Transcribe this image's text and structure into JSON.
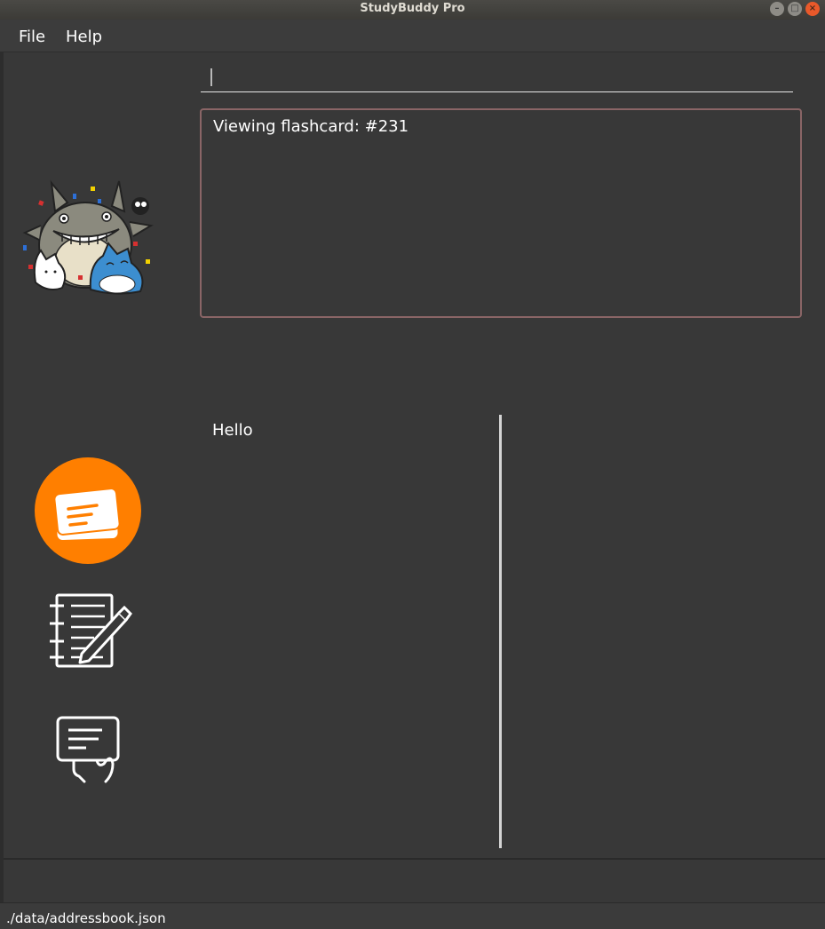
{
  "window": {
    "title": "StudyBuddy Pro",
    "buttons": {
      "minimize": "–",
      "maximize": "□",
      "close": "×"
    }
  },
  "menu": {
    "file": "File",
    "help": "Help"
  },
  "command": {
    "value": ""
  },
  "result": {
    "text": "Viewing flashcard: #231"
  },
  "flashcard": {
    "text": "Hello"
  },
  "sidebar": {
    "items": [
      {
        "icon": "flashcards-icon",
        "active": true
      },
      {
        "icon": "notes-icon",
        "active": false
      },
      {
        "icon": "quiz-icon",
        "active": false
      }
    ]
  },
  "status": {
    "path": "./data/addressbook.json"
  },
  "colors": {
    "accent": "#ff7f00",
    "background": "#383838",
    "result_border": "#8a6566"
  }
}
